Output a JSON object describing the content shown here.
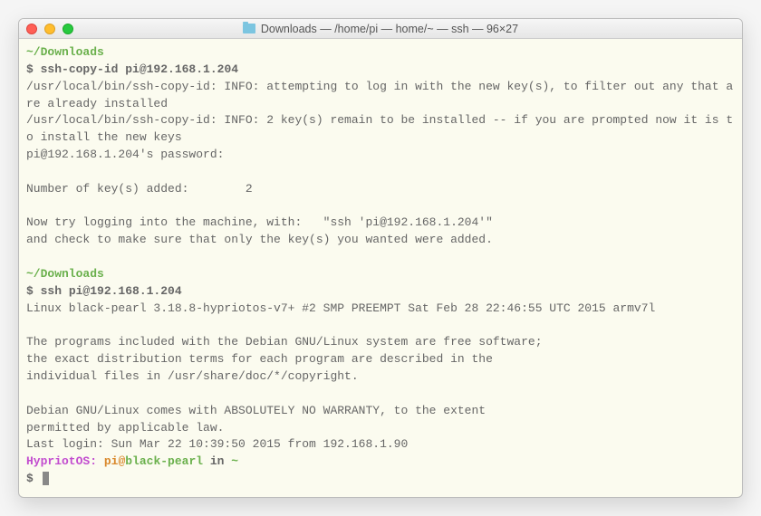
{
  "window": {
    "title": "Downloads — /home/pi — home/~ — ssh — 96×27"
  },
  "term": {
    "cwd1": "~/Downloads",
    "prompt1": "$ ",
    "cmd1": "ssh-copy-id pi@192.168.1.204",
    "info1": "/usr/local/bin/ssh-copy-id: INFO: attempting to log in with the new key(s), to filter out any that are already installed",
    "info2": "/usr/local/bin/ssh-copy-id: INFO: 2 key(s) remain to be installed -- if you are prompted now it is to install the new keys",
    "pw": "pi@192.168.1.204's password:",
    "added": "Number of key(s) added:        2",
    "try1": "Now try logging into the machine, with:   \"ssh 'pi@192.168.1.204'\"",
    "try2": "and check to make sure that only the key(s) you wanted were added.",
    "cwd2": "~/Downloads",
    "prompt2": "$ ",
    "cmd2": "ssh pi@192.168.1.204",
    "uname": "Linux black-pearl 3.18.8-hypriotos-v7+ #2 SMP PREEMPT Sat Feb 28 22:46:55 UTC 2015 armv7l",
    "motd1": "The programs included with the Debian GNU/Linux system are free software;",
    "motd2": "the exact distribution terms for each program are described in the",
    "motd3": "individual files in /usr/share/doc/*/copyright.",
    "motd4": "Debian GNU/Linux comes with ABSOLUTELY NO WARRANTY, to the extent",
    "motd5": "permitted by applicable law.",
    "lastlogin": "Last login: Sun Mar 22 10:39:50 2015 from 192.168.1.90",
    "ps1_os": "HypriotOS: ",
    "ps1_user": "pi",
    "ps1_at": "@",
    "ps1_host": "black-pearl",
    "ps1_in": " in ",
    "ps1_dir": "~",
    "prompt3": "$ "
  }
}
